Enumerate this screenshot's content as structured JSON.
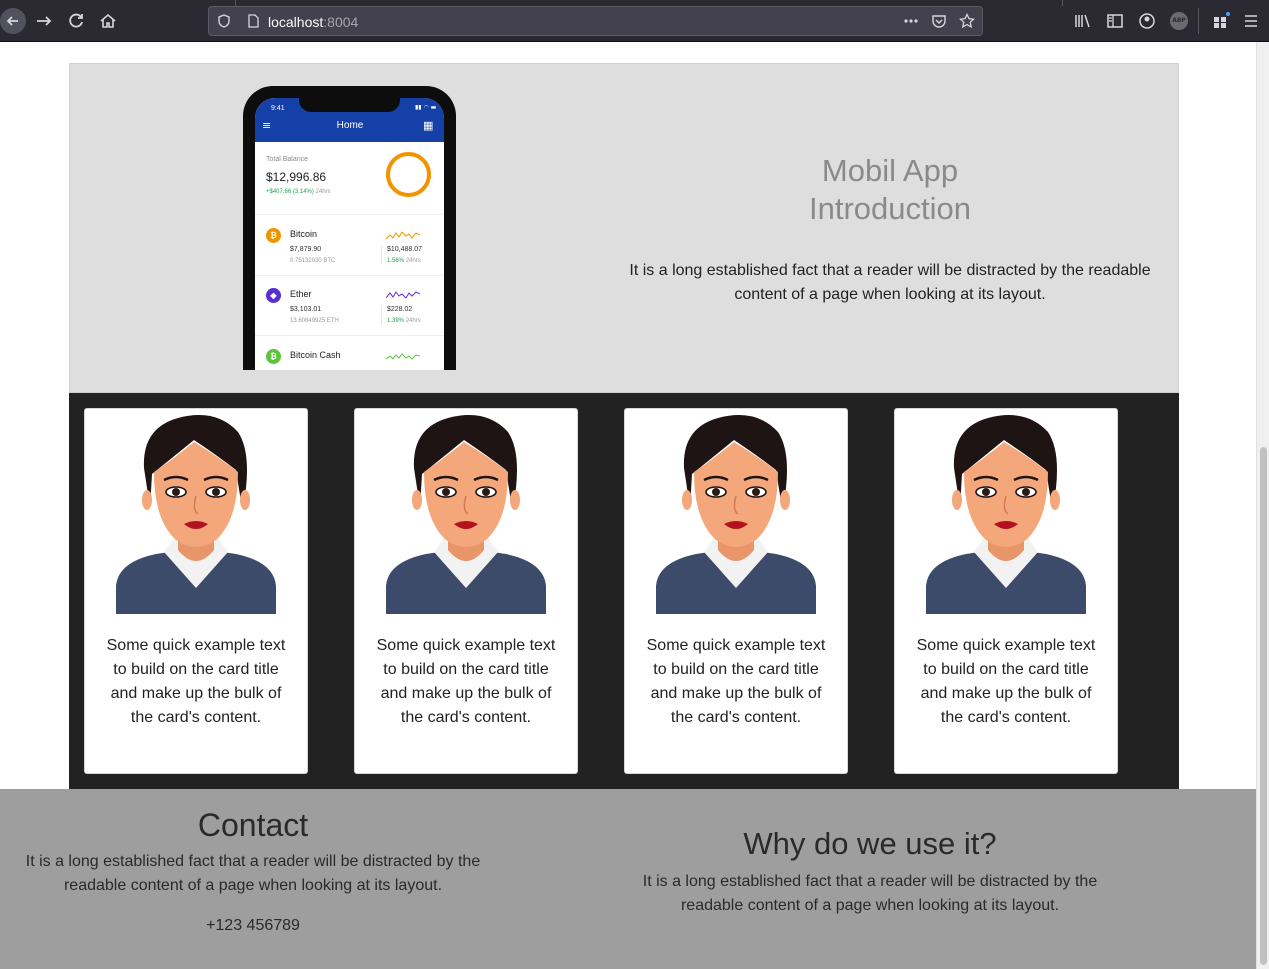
{
  "browser": {
    "url_host": "localhost",
    "url_port": ":8004",
    "icons": {
      "back": "arrow-left-icon",
      "forward": "arrow-right-icon",
      "reload": "reload-icon",
      "home": "home-icon",
      "shield": "shield-icon",
      "page": "page-icon",
      "more": "more-icon",
      "pocket": "pocket-icon",
      "bookmark": "star-icon",
      "library": "library-icon",
      "sidebar": "sidebar-icon",
      "account": "account-icon",
      "adblock": "abp-icon",
      "extensions": "extensions-icon",
      "menu": "hamburger-menu-icon"
    },
    "adblock_label": "ABP"
  },
  "intro": {
    "title_line1": "Mobil App",
    "title_line2": "Introduction",
    "text": "It is a long established fact that a reader will be distracted by the readable content of a page when looking at its layout.",
    "background": "#dedede"
  },
  "phone": {
    "time": "9:41",
    "title": "Home",
    "balance_label": "Total Balance",
    "balance": "$12,996.86",
    "change": "+$407.66 (3.14%)",
    "change_period": "24hrs",
    "coins": [
      {
        "name": "Bitcoin",
        "symbol": "₿",
        "color": "#f29400",
        "price": "$7,879.90",
        "amount": "0.75132030 BTC",
        "value": "$10,488.07",
        "pct": "1.56%",
        "period": "24hrs"
      },
      {
        "name": "Ether",
        "symbol": "◆",
        "color": "#5a2fd0",
        "price": "$3,103.01",
        "amount": "13.60849925 ETH",
        "value": "$228.02",
        "pct": "1.39%",
        "period": "24hrs"
      },
      {
        "name": "Bitcoin Cash",
        "symbol": "₿",
        "color": "#5cc43b"
      }
    ]
  },
  "cards": [
    {
      "text": "Some quick example text to build on the card title and make up the bulk of the card's content."
    },
    {
      "text": "Some quick example text to build on the card title and make up the bulk of the card's content."
    },
    {
      "text": "Some quick example text to build on the card title and make up the bulk of the card's content."
    },
    {
      "text": "Some quick example text to build on the card title and make up the bulk of the card's content."
    }
  ],
  "footer": {
    "contact_title": "Contact",
    "contact_text": "It is a long established fact that a reader will be distracted by the readable content of a page when looking at its layout.",
    "contact_phone": "+123 456789",
    "why_title": "Why do we use it?",
    "why_text": "It is a long established fact that a reader will be distracted by the readable content of a page when looking at its layout."
  },
  "colors": {
    "cards_background": "#222222",
    "footer_background": "#9e9e9e",
    "sweater": "#3d4b6b",
    "hair": "#1f1414",
    "skin": "#f4a77a"
  }
}
